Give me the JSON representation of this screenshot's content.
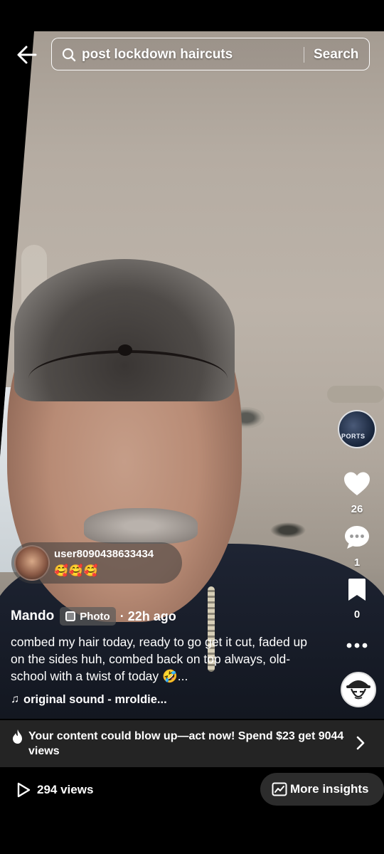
{
  "search": {
    "query": "post lockdown haircuts",
    "button_label": "Search"
  },
  "rail": {
    "avatar_text": "PORTS",
    "likes": "26",
    "comments": "1",
    "saves": "0"
  },
  "comment_preview": {
    "username": "user8090438633434",
    "text": "🥰🥰🥰"
  },
  "post": {
    "author": "Mando",
    "type_label": "Photo",
    "time_ago": "· 22h ago",
    "caption": "combed my hair today, ready to go get it cut, faded up on the sides huh, combed back on top always, old-school with a twist of today 🤣...",
    "sound": "original sound - mroldie..."
  },
  "promo": {
    "text": "Your content could blow up—act now! Spend $23 get 9044 views"
  },
  "footer": {
    "views_label": "294 views",
    "insights_label": "More insights"
  },
  "icons": {
    "back": "arrow-left-icon",
    "search": "search-icon",
    "like": "heart-icon",
    "comment": "comment-icon",
    "save": "bookmark-icon",
    "more": "more-dots-icon",
    "music": "music-note-icon",
    "promo": "flame-icon",
    "chevron": "chevron-right-icon",
    "play": "play-icon",
    "insights": "chart-icon"
  }
}
